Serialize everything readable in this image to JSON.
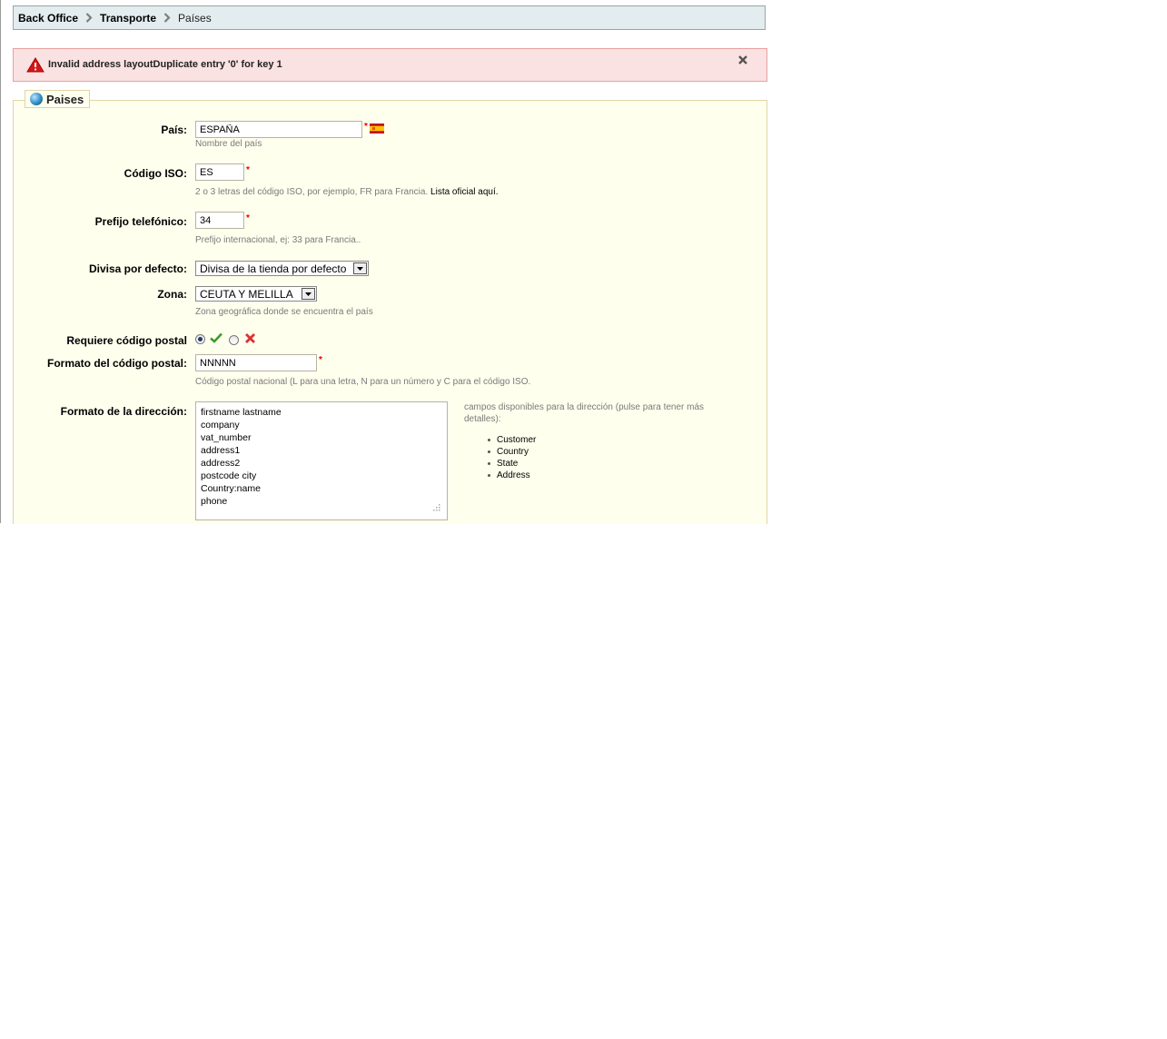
{
  "breadcrumb": {
    "items": [
      "Back Office",
      "Transporte",
      "Países"
    ]
  },
  "error": {
    "message": "Invalid address layoutDuplicate entry '0' for key 1"
  },
  "section": {
    "title": "Paises"
  },
  "form": {
    "country": {
      "label": "País:",
      "value": "ESPAÑA",
      "required": "*",
      "hint": "Nombre del país",
      "flag_icon": "spain-flag-icon"
    },
    "iso": {
      "label": "Código ISO:",
      "value": "ES",
      "required": "*",
      "hint": "2 o 3 letras del código ISO, por ejemplo, FR para Francia.",
      "hint_link": "Lista oficial aquí."
    },
    "phone_prefix": {
      "label": "Prefijo telefónico:",
      "value": "34",
      "required": "*",
      "hint": "Prefijo internacional, ej: 33 para Francia.."
    },
    "currency": {
      "label": "Divisa por defecto:",
      "selected": "Divisa de la tienda por defecto"
    },
    "zone": {
      "label": "Zona:",
      "selected": "CEUTA Y MELILLA",
      "hint": "Zona geográfica donde se encuentra el país"
    },
    "zip_required": {
      "label": "Requiere código postal",
      "selected": "yes"
    },
    "zip_format": {
      "label": "Formato del código postal:",
      "value": "NNNNN",
      "required": "*",
      "hint": "Código postal nacional (L para una letra, N para un número y C para el código ISO."
    },
    "address_format": {
      "label": "Formato de la dirección:",
      "value": "firstname lastname\ncompany\nvat_number\naddress1\naddress2\npostcode city\nCountry:name\nphone",
      "help": "campos disponibles para la dirección (pulse para tener más detalles):",
      "fields": [
        "Customer",
        "Country",
        "State",
        "Address"
      ]
    }
  },
  "colors": {
    "breadcrumb_bg": "#e3ecee",
    "error_bg": "#fbe2e2",
    "fieldset_bg": "#ffffee",
    "required": "#ee0000"
  }
}
